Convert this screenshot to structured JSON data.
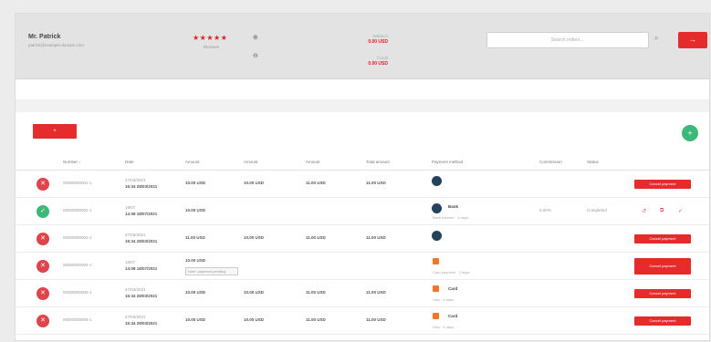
{
  "header": {
    "account_name": "Mr. Patrick",
    "account_sub": "patrick@example-domain.com",
    "rating_stars": "★★★★★",
    "rating_sub": "Reviews",
    "icon_top": "⊕",
    "icon_bottom": "⊖",
    "stats": [
      {
        "label": "Balance",
        "value": "0.00 USD"
      },
      {
        "label": "Credit",
        "value": "0.00 USD"
      }
    ],
    "search_placeholder": "Search orders…",
    "search_button": "→"
  },
  "toolbar": {
    "add_button": "+",
    "fab": "+"
  },
  "table": {
    "headers": [
      "Number ↓",
      "Date",
      "Amount",
      "Amount",
      "Amount",
      "Total amount",
      "Payment method",
      "Commission",
      "Status"
    ],
    "rows": [
      {
        "status": "red",
        "number": "00000000001-1",
        "date1": "27/03/2021",
        "date2": "15:34 28/03/2021",
        "amounts": [
          "10.00 USD",
          "10.00 USD",
          "11.00 USD",
          "11.00 USD"
        ],
        "pay_type": "avatar",
        "pay_name": "",
        "pay_sub": "",
        "commission": "",
        "status_text": "",
        "action": "Cancel payment",
        "action_type": "button"
      },
      {
        "status": "green",
        "number": "00000000002-1",
        "date1": "18/07",
        "date2": "14:08 18/07/2021",
        "amounts": [
          "10.00 USD",
          "",
          "",
          ""
        ],
        "pay_type": "avatar",
        "pay_name": "Bank",
        "pay_sub": "Bank transfer · 4 days",
        "commission": "0.00%",
        "status_text": "Completed",
        "action": "↺ ⧉ ✓",
        "action_type": "icons"
      },
      {
        "status": "red",
        "number": "00000000003-1",
        "date1": "27/03/2021",
        "date2": "15:34 28/03/2021",
        "amounts": [
          "11.00 USD",
          "10.00 USD",
          "11.00 USD",
          "11.00 USD"
        ],
        "pay_type": "avatar",
        "pay_name": "",
        "pay_sub": "",
        "commission": "",
        "status_text": "",
        "action": "Cancel payment",
        "action_type": "button"
      },
      {
        "status": "red",
        "number": "00000000004-1",
        "date1": "18/07",
        "date2": "14:08 18/07/2021",
        "amounts": [
          "10.00 USD",
          "",
          "",
          ""
        ],
        "note": "Note: payment pending",
        "pay_type": "flag",
        "pay_name": "",
        "pay_sub": "Card payment · 2 days",
        "commission": "",
        "status_text": "",
        "action": "Cancel payment",
        "action_type": "tall"
      },
      {
        "status": "red",
        "number": "00000000005-1",
        "date1": "27/03/2021",
        "date2": "15:34 28/03/2021",
        "amounts": [
          "10.00 USD",
          "10.00 USD",
          "11.00 USD",
          "11.00 USD"
        ],
        "pay_type": "flag",
        "pay_name": "Card",
        "pay_sub": "Visa · 4 days",
        "commission": "",
        "status_text": "",
        "action": "Cancel payment",
        "action_type": "button"
      },
      {
        "status": "red",
        "number": "00000000006-1",
        "date1": "27/03/2021",
        "date2": "15:34 28/03/2021",
        "amounts": [
          "10.00 USD",
          "10.00 USD",
          "11.00 USD",
          "11.00 USD"
        ],
        "pay_type": "flag",
        "pay_name": "Card",
        "pay_sub": "Visa · 4 days",
        "commission": "",
        "status_text": "",
        "action": "Cancel payment",
        "action_type": "button"
      }
    ]
  },
  "colors": {
    "accent": "#e52b2b",
    "success": "#3cb878",
    "avatar": "#24425c"
  }
}
